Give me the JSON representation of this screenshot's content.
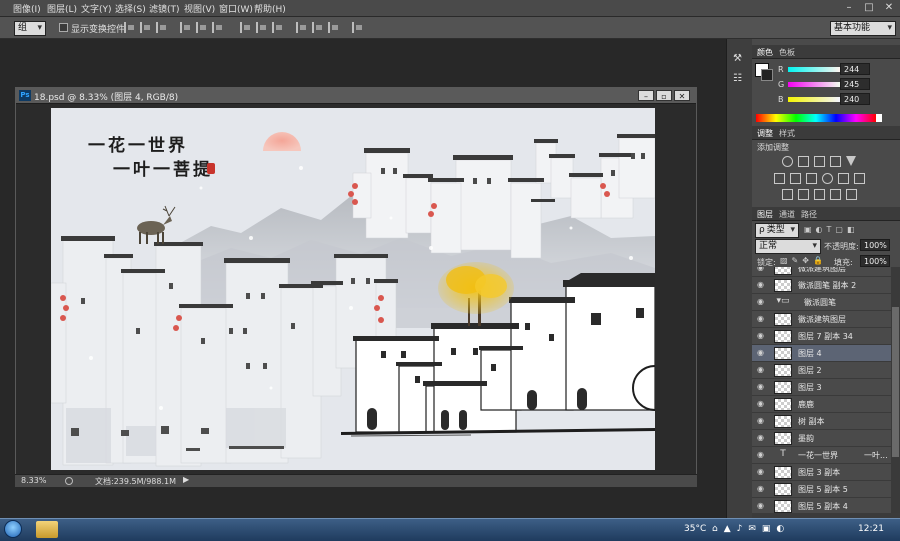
{
  "menu": [
    "图像(I)",
    "图层(L)",
    "文字(Y)",
    "选择(S)",
    "滤镜(T)",
    "视图(V)",
    "窗口(W)",
    "帮助(H)"
  ],
  "options": {
    "group_label": "组",
    "show_transform": "显示变换控件",
    "workspace": "基本功能"
  },
  "document": {
    "title": "18.psd @ 8.33% (图层 4, RGB/8)",
    "zoom": "8.33%",
    "doc_info": "文档:239.5M/988.1M"
  },
  "artwork": {
    "line1": "一花一世界",
    "line2": "一叶一菩提"
  },
  "color_panel": {
    "tabs": [
      "颜色",
      "色板"
    ],
    "r_label": "R",
    "g_label": "G",
    "b_label": "B",
    "r": "244",
    "g": "245",
    "b": "240"
  },
  "adjust_panel": {
    "tabs": [
      "调整",
      "样式"
    ],
    "title": "添加调整"
  },
  "layers_panel": {
    "tabs": [
      "图层",
      "通道",
      "路径"
    ],
    "kind": "类型",
    "blend": "正常",
    "opacity_label": "不透明度:",
    "opacity": "100%",
    "lock_label": "锁定:",
    "fill_label": "填充:",
    "fill": "100%",
    "layers": [
      {
        "name": "微派建筑图层",
        "type": "pixel"
      },
      {
        "name": "徽派圆笔 副本 2",
        "type": "pixel"
      },
      {
        "name": "徽派圆笔",
        "type": "group"
      },
      {
        "name": "徽派建筑图层",
        "type": "pixel"
      },
      {
        "name": "图层 7 副本 34",
        "type": "pixel"
      },
      {
        "name": "图层 4",
        "type": "pixel",
        "selected": true
      },
      {
        "name": "图层 2",
        "type": "pixel"
      },
      {
        "name": "图层 3",
        "type": "pixel"
      },
      {
        "name": "鹿鹿",
        "type": "pixel"
      },
      {
        "name": "树 副本",
        "type": "pixel"
      },
      {
        "name": "墨韵",
        "type": "pixel"
      },
      {
        "name": "一花一世界",
        "fx": "一叶...",
        "type": "text"
      },
      {
        "name": "图层 3 副本",
        "type": "pixel"
      },
      {
        "name": "图层 5 副本 5",
        "type": "pixel"
      },
      {
        "name": "图层 5 副本 4",
        "type": "pixel"
      }
    ]
  },
  "taskbar": {
    "temp": "35°C",
    "time": "12:21"
  },
  "colors": {
    "canvas_bg": "#e4e7ec",
    "sun": "#f2a79b",
    "selected_layer": "#5c6474"
  }
}
